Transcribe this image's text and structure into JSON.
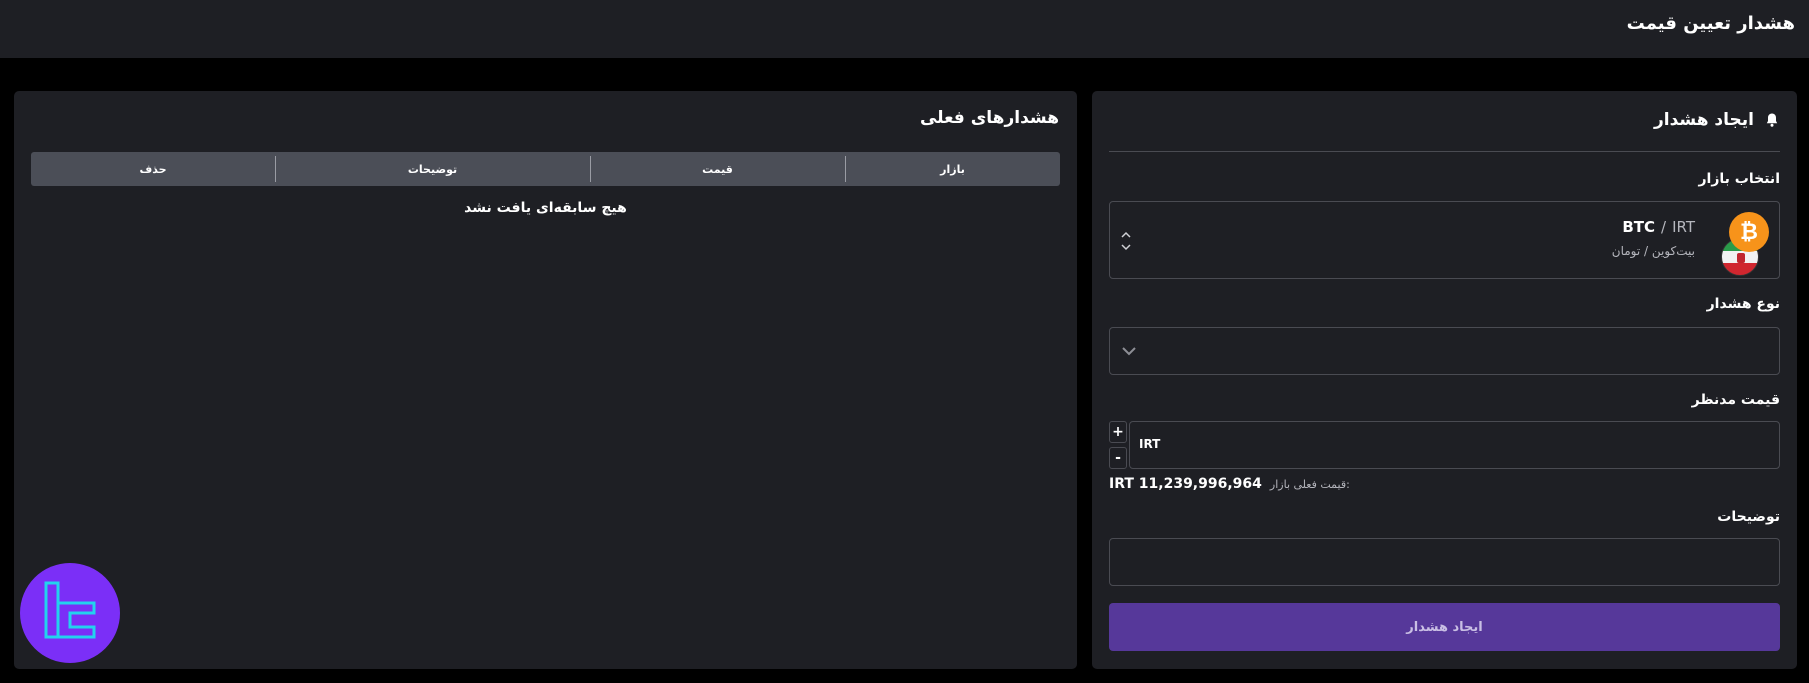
{
  "header": {
    "title": "هشدار تعیین قیمت"
  },
  "create_alert": {
    "title": "ایجاد هشدار",
    "market_label": "انتخاب بازار",
    "market": {
      "base": "BTC",
      "separator": "/",
      "quote": "IRT",
      "subtitle": "بیت‌کوین / تومان"
    },
    "type_label": "نوع هشدار",
    "type_value": "",
    "price_label": "قیمت مدنظر",
    "price_value": "IRT",
    "plus": "+",
    "minus": "-",
    "current_price_label": "قیمت فعلی بازار:",
    "current_price_value": "IRT 11,239,996,964",
    "desc_label": "توضیحات",
    "submit_label": "ایجاد هشدار"
  },
  "current_alerts": {
    "title": "هشدارهای فعلی",
    "columns": [
      "بازار",
      "قیمت",
      "توضیحات",
      "حذف"
    ],
    "empty_message": "هیچ سابقه‌ای یافت نشد"
  },
  "colors": {
    "background": "#000000",
    "panel": "#1e1f24",
    "table_header": "#4b4e57",
    "button": "#56389a",
    "btc": "#f7931a",
    "logo": "#7b2ff7"
  }
}
